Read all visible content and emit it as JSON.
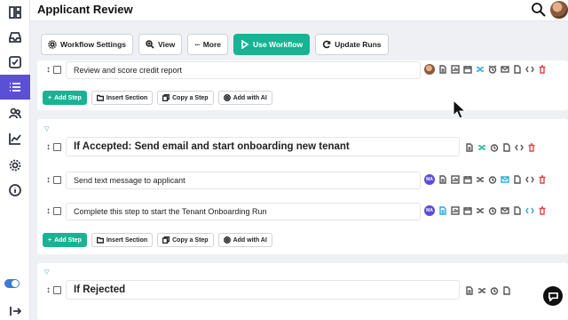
{
  "header": {
    "title": "Applicant Review"
  },
  "toolbar": {
    "workflow_settings": "Workflow Settings",
    "view": "View",
    "more": "More",
    "use_workflow": "Use Workflow",
    "update_runs": "Update Runs"
  },
  "actions": {
    "add_step": "Add Step",
    "insert_section": "Insert Section",
    "copy_step": "Copy a Step",
    "add_ai": "Add with AI"
  },
  "sections": {
    "top_step": "Review and score credit report",
    "accepted": {
      "title": "If Accepted: Send email and start onboarding new tenant",
      "steps": [
        {
          "label": "Send text message to applicant",
          "assignee": "MA"
        },
        {
          "label": "Complete this step to start the Tenant Onboarding Run",
          "assignee": "MA"
        }
      ]
    },
    "rejected": {
      "title": "If Rejected"
    }
  },
  "colors": {
    "accent": "#19b394",
    "sidebar_active": "#5b4fd6",
    "delete": "#e0454d"
  }
}
